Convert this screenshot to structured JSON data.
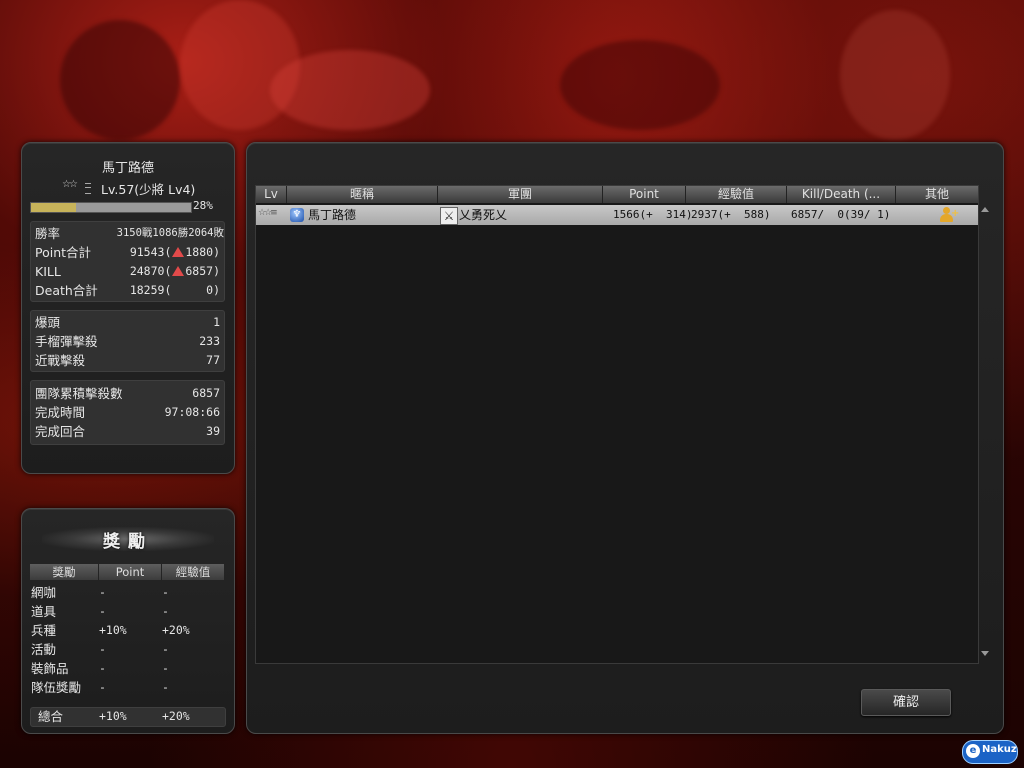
{
  "player": {
    "name": "馬丁路德",
    "level_text": "Lv.57(少將 Lv4)",
    "exp_percent": 28,
    "exp_percent_text": "28%"
  },
  "stats_group1": [
    {
      "label": "勝率",
      "value": "3150戰1086勝2064敗"
    },
    {
      "label": "Point合計",
      "value": "91543(",
      "delta": "1880)"
    },
    {
      "label": "KILL",
      "value": "24870(",
      "delta": "6857)"
    },
    {
      "label": "Death合計",
      "value": "18259(",
      "delta": "   0)"
    }
  ],
  "stats_group2": [
    {
      "label": "爆頭",
      "value": "1"
    },
    {
      "label": "手榴彈擊殺",
      "value": "233"
    },
    {
      "label": "近戰擊殺",
      "value": "77"
    }
  ],
  "stats_group3": [
    {
      "label": "團隊累積擊殺數",
      "value": "6857"
    },
    {
      "label": "完成時間",
      "value": "97:08:66"
    },
    {
      "label": "完成回合",
      "value": "39"
    }
  ],
  "rewards": {
    "title": "獎勵",
    "headers": [
      "獎勵",
      "Point",
      "經驗值"
    ],
    "rows": [
      {
        "name": "網咖",
        "point": "-",
        "exp": "-"
      },
      {
        "name": "道具",
        "point": "-",
        "exp": "-"
      },
      {
        "name": "兵種",
        "point": "+10%",
        "exp": "+20%"
      },
      {
        "name": "活動",
        "point": "-",
        "exp": "-"
      },
      {
        "name": "裝飾品",
        "point": "-",
        "exp": "-"
      },
      {
        "name": "隊伍獎勵",
        "point": "-",
        "exp": "-"
      }
    ],
    "total": {
      "name": "總合",
      "point": "+10%",
      "exp": "+20%"
    }
  },
  "table": {
    "headers": [
      "Lv",
      "暱稱",
      "軍團",
      "Point",
      "經驗值",
      "Kill/Death (...",
      "其他"
    ],
    "rows": [
      {
        "nickname": "馬丁路德",
        "clan": "乂勇死乂",
        "point": "1566(+  314)",
        "exp": "2937(+  588)",
        "kd": "6857/  0(39/ 1)"
      }
    ]
  },
  "confirm_label": "確認",
  "watermark": "Nakuz"
}
